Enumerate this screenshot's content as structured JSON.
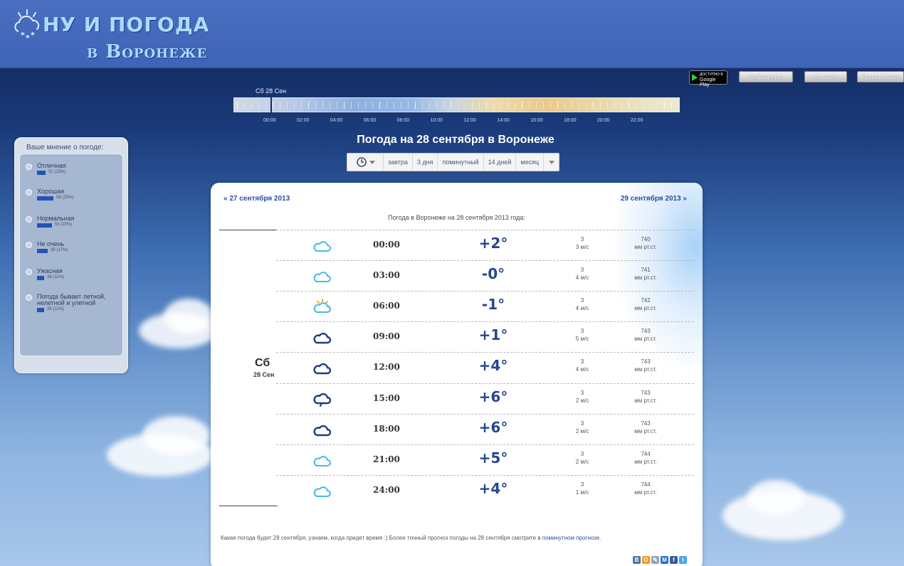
{
  "header": {
    "logo_line1": "НУ И ПОГОДА",
    "logo_line2": "в Воронеже",
    "colors": {
      "logo_text": "#a9dcff",
      "header_bg": "#4a6fc0"
    }
  },
  "top_buttons": {
    "google_play_small": "ДОСТУПНО В",
    "google_play": "Google Play",
    "informers": "Информеры",
    "on_map": "На карте",
    "other_weather": "Другая погода"
  },
  "timeline": {
    "label": "Сб 28 Сен",
    "hours": [
      "00:00",
      "02:00",
      "04:00",
      "06:00",
      "08:00",
      "10:00",
      "12:00",
      "14:00",
      "16:00",
      "18:00",
      "20:00",
      "22:00"
    ]
  },
  "title": "Погода на 28 сентября в Воронеже",
  "tabs": [
    "завтра",
    "3 дня",
    "поминутный",
    "14 дней",
    "месяц"
  ],
  "poll": {
    "title": "Ваше мнение о погоде:",
    "options": [
      {
        "label": "Отличная",
        "count": "31 (13%)",
        "share": 0.13
      },
      {
        "label": "Хорошая",
        "count": "58 (25%)",
        "share": 0.25
      },
      {
        "label": "Нормальная",
        "count": "53 (23%)",
        "share": 0.23
      },
      {
        "label": "Не очень",
        "count": "39 (17%)",
        "share": 0.17
      },
      {
        "label": "Ужасная",
        "count": "26 (11%)",
        "share": 0.11
      },
      {
        "label": "Погода бывает летной, нелетной и улетной",
        "count": "26 (11%)",
        "share": 0.11
      }
    ]
  },
  "card": {
    "prev": "« 27 сентября 2013",
    "next": "29 сентября 2013 »",
    "subtitle": "Погода в Воронеже на 28 сентября 2013 года:",
    "day_name": "Сб",
    "day_date": "28 Сен",
    "rows": [
      {
        "time": "00:00",
        "temp": "+2°",
        "wind_dir": "3",
        "wind": "3 м/с",
        "press": "740",
        "press_unit": "мм рт.ст.",
        "icon": "cloud-light-icon"
      },
      {
        "time": "03:00",
        "temp": "-0°",
        "wind_dir": "3",
        "wind": "4 м/с",
        "press": "741",
        "press_unit": "мм рт.ст.",
        "icon": "cloud-light-icon"
      },
      {
        "time": "06:00",
        "temp": "-1°",
        "wind_dir": "3",
        "wind": "4 м/с",
        "press": "742",
        "press_unit": "мм рт.ст.",
        "icon": "sun-cloud-icon"
      },
      {
        "time": "09:00",
        "temp": "+1°",
        "wind_dir": "3",
        "wind": "5 м/с",
        "press": "743",
        "press_unit": "мм рт.ст.",
        "icon": "cloud-dark-icon"
      },
      {
        "time": "12:00",
        "temp": "+4°",
        "wind_dir": "3",
        "wind": "4 м/с",
        "press": "743",
        "press_unit": "мм рт.ст.",
        "icon": "cloud-dark-icon"
      },
      {
        "time": "15:00",
        "temp": "+6°",
        "wind_dir": "3",
        "wind": "2 м/с",
        "press": "743",
        "press_unit": "мм рт.ст.",
        "icon": "cloud-rain-icon"
      },
      {
        "time": "18:00",
        "temp": "+6°",
        "wind_dir": "3",
        "wind": "2 м/с",
        "press": "743",
        "press_unit": "мм рт.ст.",
        "icon": "cloud-dark-icon"
      },
      {
        "time": "21:00",
        "temp": "+5°",
        "wind_dir": "3",
        "wind": "2 м/с",
        "press": "744",
        "press_unit": "мм рт.ст.",
        "icon": "cloud-light-icon"
      },
      {
        "time": "24:00",
        "temp": "+4°",
        "wind_dir": "3",
        "wind": "1 м/с",
        "press": "744",
        "press_unit": "мм рт.ст.",
        "icon": "cloud-light-icon"
      }
    ],
    "footnote_text": "Какая погода будет 28 сентября, узнаем, когда придет время :) Более точный прогноз погоды на 28 сентября смотрите в ",
    "footnote_link": "поминутном прогнозе",
    "footnote_end": ".",
    "share": [
      {
        "label": "В",
        "color": "#4c75a3"
      },
      {
        "label": "О",
        "color": "#f59a1d"
      },
      {
        "label": "✎",
        "color": "#9aa4b3"
      },
      {
        "label": "М",
        "color": "#1f6fd0"
      },
      {
        "label": "f",
        "color": "#3b5998"
      },
      {
        "label": "t",
        "color": "#4aa6e8"
      }
    ]
  }
}
